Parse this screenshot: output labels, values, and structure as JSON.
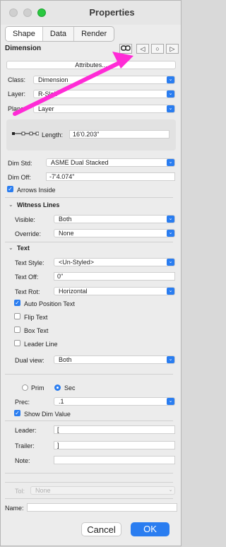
{
  "window": {
    "title": "Properties"
  },
  "tabs": [
    "Shape",
    "Data",
    "Render"
  ],
  "object": {
    "type_label": "Dimension",
    "attributes_button": "Attributes...",
    "nav_icons": [
      "link-icon",
      "prev-icon",
      "circle-icon",
      "next-icon"
    ]
  },
  "fields": {
    "class_label": "Class:",
    "class_value": "Dimension",
    "layer_label": "Layer:",
    "layer_value": "R-Slab",
    "plane_label": "Plane:",
    "plane_value": "Layer",
    "length_label": "Length:",
    "length_value": "16'0.203\"",
    "dimstd_label": "Dim Std:",
    "dimstd_value": "ASME Dual Stacked",
    "dimoff_label": "Dim Off:",
    "dimoff_value": "-7'4.074\"",
    "arrows_inside_label": "Arrows Inside"
  },
  "witness": {
    "header": "Witness Lines",
    "visible_label": "Visible:",
    "visible_value": "Both",
    "override_label": "Override:",
    "override_value": "None"
  },
  "text": {
    "header": "Text",
    "style_label": "Text Style:",
    "style_value": "<Un-Styled>",
    "off_label": "Text Off:",
    "off_value": "0\"",
    "rot_label": "Text Rot:",
    "rot_value": "Horizontal",
    "auto_position_label": "Auto Position Text",
    "flip_label": "Flip Text",
    "box_label": "Box Text",
    "leader_line_label": "Leader Line",
    "dual_view_label": "Dual view:",
    "dual_view_value": "Both"
  },
  "prim_sec": {
    "prim_label": "Prim",
    "sec_label": "Sec",
    "prec_label": "Prec:",
    "prec_value": ".1",
    "show_dim_label": "Show Dim Value",
    "leader_label": "Leader:",
    "leader_value": "[",
    "trailer_label": "Trailer:",
    "trailer_value": "]",
    "note_label": "Note:",
    "note_value": ""
  },
  "tol": {
    "label": "Tol:",
    "value": "None"
  },
  "name": {
    "label": "Name:",
    "value": ""
  },
  "buttons": {
    "cancel": "Cancel",
    "ok": "OK"
  },
  "colors": {
    "accent": "#2a7df0",
    "annotation_arrow": "#ff2bd6"
  }
}
